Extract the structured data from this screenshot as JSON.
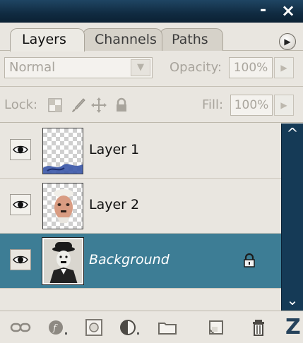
{
  "window": {
    "minimize_label": "-",
    "close_label": "×"
  },
  "tabs": [
    {
      "label": "Layers",
      "active": true
    },
    {
      "label": "Channels",
      "active": false
    },
    {
      "label": "Paths",
      "active": false
    }
  ],
  "panel_menu_icon": "triangle-right-icon",
  "blend": {
    "value": "Normal",
    "opacity_label": "Opacity:",
    "opacity_value": "100%"
  },
  "lock": {
    "label": "Lock:",
    "icons": [
      "lock-transparent-icon",
      "lock-image-brush-icon",
      "lock-position-move-icon",
      "lock-all-icon"
    ],
    "fill_label": "Fill:",
    "fill_value": "100%"
  },
  "layers": [
    {
      "name": "Layer 1",
      "visible": true,
      "selected": false,
      "locked": false
    },
    {
      "name": "Layer 2",
      "visible": true,
      "selected": false,
      "locked": false
    },
    {
      "name": "Background",
      "visible": true,
      "selected": true,
      "locked": true
    }
  ],
  "scrollbar": {
    "up_label": "^",
    "down_label": "⌄"
  },
  "bottom_icons": [
    "link-layers-icon",
    "layer-style-fx-icon",
    "add-mask-icon",
    "adjustment-layer-icon",
    "new-group-folder-icon",
    "new-layer-icon",
    "delete-layer-trash-icon"
  ],
  "colors": {
    "titlebar": "#153a56",
    "selection": "#3d7d95",
    "panel_bg": "#e9e6e0"
  }
}
